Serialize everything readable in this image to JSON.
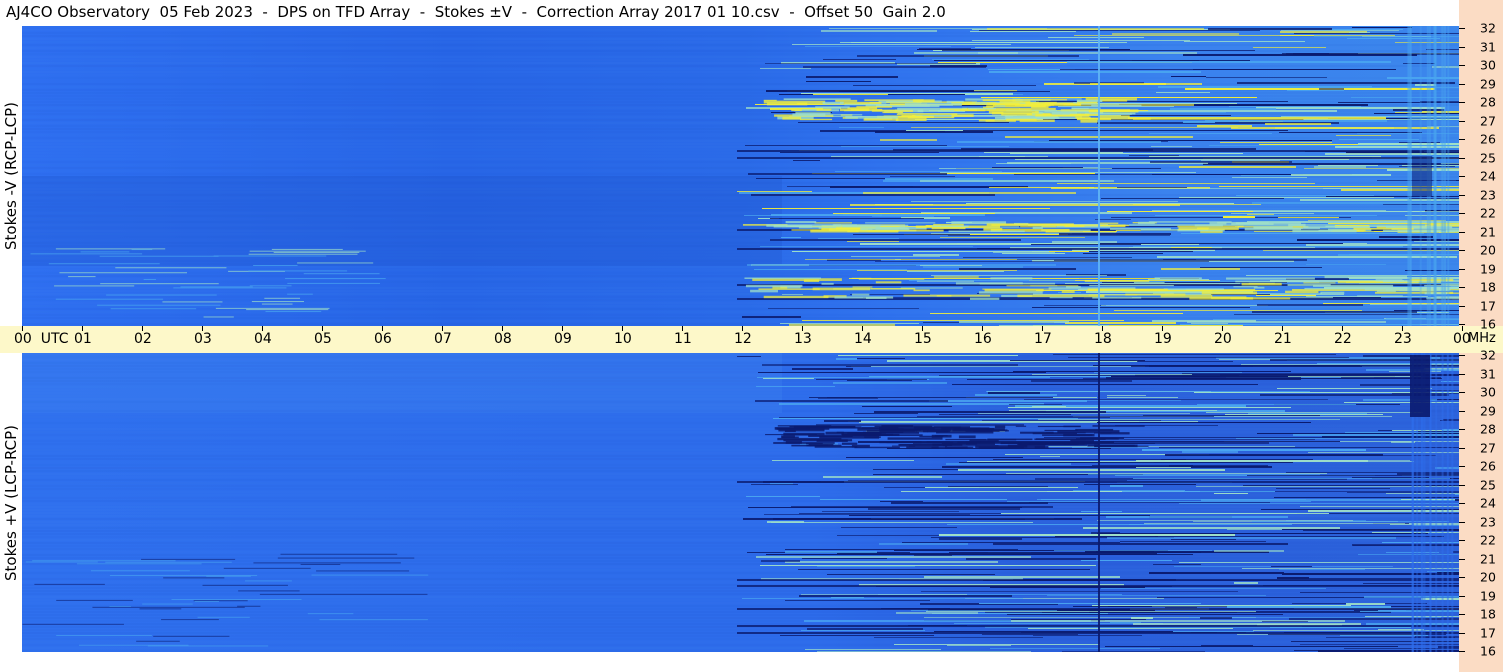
{
  "title": "AJ4CO Observatory  05 Feb 2023  -  DPS on TFD Array  -  Stokes ±V  -  Correction Array 2017 01 10.csv  -  Offset 50  Gain 2.0",
  "chart_data": [
    {
      "type": "heatmap",
      "panel": "top",
      "ylabel": "Stokes -V (RCP-LCP)",
      "x_ticks": [
        "00 UTC",
        "01",
        "02",
        "03",
        "04",
        "05",
        "06",
        "07",
        "08",
        "09",
        "10",
        "11",
        "12",
        "13",
        "14",
        "15",
        "16",
        "17",
        "18",
        "19",
        "20",
        "21",
        "22",
        "23",
        "00"
      ],
      "y_ticks": [
        "32",
        "31",
        "30",
        "29",
        "28",
        "27",
        "26",
        "25",
        "24",
        "23",
        "22",
        "21",
        "20",
        "19",
        "18",
        "17",
        "16"
      ],
      "xlim": [
        0,
        24
      ],
      "ylim": [
        16,
        32
      ],
      "x_unit": "UTC",
      "y_unit": "MHz",
      "colormap": [
        "#0a1a6e",
        "#1f4fd0",
        "#2f6fee",
        "#4aa6f0",
        "#9fe0c8",
        "#f2ef3a"
      ]
    },
    {
      "type": "heatmap",
      "panel": "bottom",
      "ylabel": "Stokes +V (LCP-RCP)",
      "x_ticks": [
        "00 UTC",
        "01",
        "02",
        "03",
        "04",
        "05",
        "06",
        "07",
        "08",
        "09",
        "10",
        "11",
        "12",
        "13",
        "14",
        "15",
        "16",
        "17",
        "18",
        "19",
        "20",
        "21",
        "22",
        "23",
        "00"
      ],
      "y_ticks": [
        "32",
        "31",
        "30",
        "29",
        "28",
        "27",
        "26",
        "25",
        "24",
        "23",
        "22",
        "21",
        "20",
        "19",
        "18",
        "17",
        "16"
      ],
      "xlim": [
        0,
        24
      ],
      "ylim": [
        16,
        32
      ],
      "x_unit": "UTC",
      "y_unit": "MHz",
      "colormap": [
        "#0a1a6e",
        "#1f4fd0",
        "#2f6fee",
        "#4aa6f0",
        "#9fe0c8",
        "#f2ef3a"
      ]
    }
  ],
  "time_axis": {
    "labels": [
      "00  UTC",
      "01",
      "02",
      "03",
      "04",
      "05",
      "06",
      "07",
      "08",
      "09",
      "10",
      "11",
      "12",
      "13",
      "14",
      "15",
      "16",
      "17",
      "18",
      "19",
      "20",
      "21",
      "22",
      "23",
      "00"
    ],
    "unit_label": "MHz"
  },
  "freq_axis": {
    "labels": [
      "32",
      "31",
      "30",
      "29",
      "28",
      "27",
      "26",
      "25",
      "24",
      "23",
      "22",
      "21",
      "20",
      "19",
      "18",
      "17",
      "16"
    ]
  }
}
